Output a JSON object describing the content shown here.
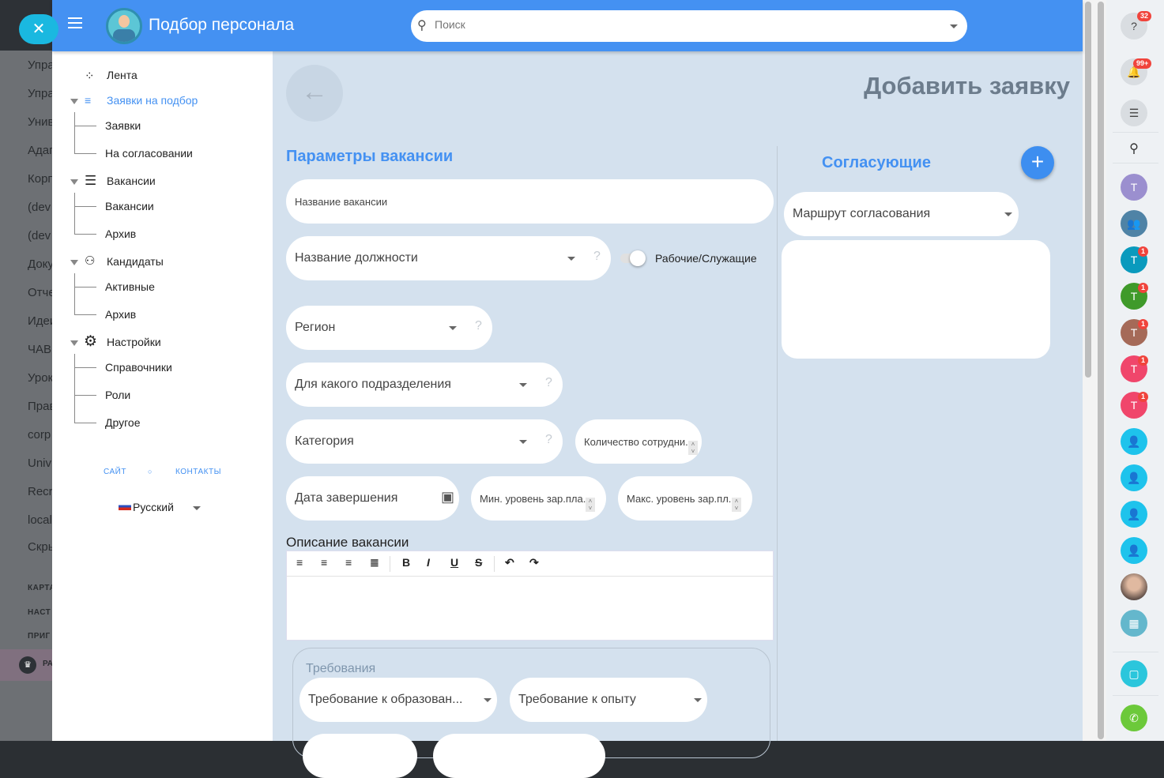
{
  "background_menu": {
    "items": [
      "Упра",
      "Упра",
      "Унив",
      "Адап",
      "Корп",
      "(dev",
      "(dev",
      "Доку",
      "Отче",
      "Идеи",
      "ЧАВ",
      "Урок",
      "Прав",
      "corp",
      "Univ",
      "Recr",
      "local",
      "Скры"
    ],
    "captions": [
      "КАРТА",
      "НАСТ",
      "ПРИГ"
    ],
    "premium": "РА"
  },
  "header": {
    "title": "Подбор персонала",
    "search_placeholder": "Поиск"
  },
  "sidebar": {
    "items": [
      {
        "label": "Лента"
      },
      {
        "label": "Заявки на подбор",
        "children": [
          "Заявки",
          "На согласовании"
        ]
      },
      {
        "label": "Вакансии",
        "children": [
          "Вакансии",
          "Архив"
        ]
      },
      {
        "label": "Кандидаты",
        "children": [
          "Активные",
          "Архив"
        ]
      },
      {
        "label": "Настройки",
        "children": [
          "Справочники",
          "Роли",
          "Другое"
        ]
      }
    ],
    "footer": {
      "site": "САЙТ",
      "contacts": "КОНТАКТЫ",
      "language": "Русский"
    }
  },
  "main": {
    "page_title": "Добавить заявку",
    "vacancy_section": "Параметры вакансии",
    "fields": {
      "vacancy_name": "Название вакансии",
      "position": "Название должности",
      "toggle_label": "Рабочие/Служащие",
      "region": "Регион",
      "department": "Для какого подразделения",
      "category": "Категория",
      "employee_count": "Количество сотрудни...",
      "end_date": "Дата завершения",
      "min_salary": "Мин. уровень зар.пла...",
      "max_salary": "Макс. уровень зар.пл..."
    },
    "description_label": "Описание вакансии",
    "requirements": {
      "label": "Требования",
      "education": "Требование к образован...",
      "experience": "Требование к опыту"
    },
    "approvers_section": "Согласующие",
    "route": "Маршрут согласования"
  },
  "right_panel": {
    "help_badge": "32",
    "notif_badge": "99+",
    "avatar_letter": "Т",
    "chat_badges": [
      "1",
      "1",
      "1",
      "1"
    ],
    "colors": {
      "purple": "#9b8fcf",
      "teal": "#0a9abd",
      "green": "#3f9a2a",
      "brown": "#a56a58",
      "pink": "#f0466b",
      "cyan": "#1ec3ec",
      "call": "#6cc93a"
    }
  }
}
